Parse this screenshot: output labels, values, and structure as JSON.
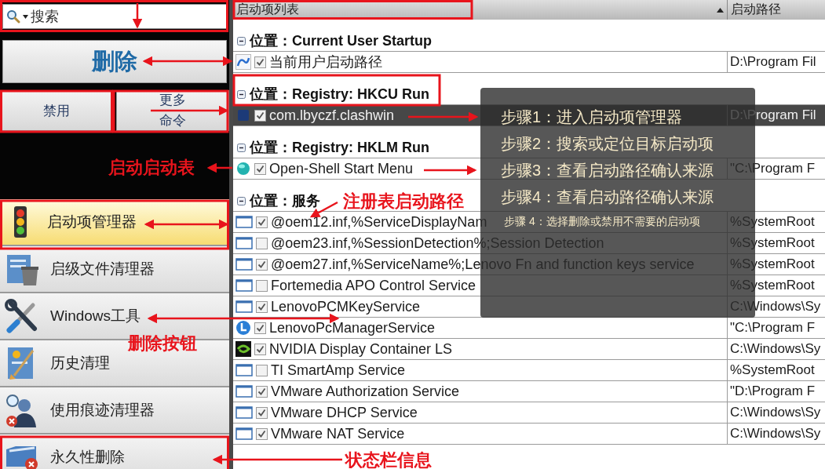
{
  "sidebar": {
    "search": {
      "placeholder": "搜索"
    },
    "delete_button": "删除",
    "buttons": [
      "禁用",
      "更多命令"
    ],
    "nav": [
      {
        "label": "启动项管理器",
        "selected": true
      },
      {
        "label": "启级文件清理器",
        "selected": false
      },
      {
        "label": "Windows工具",
        "selected": false
      },
      {
        "label": "历史清理",
        "selected": false
      },
      {
        "label": "使用痕迹清理器",
        "selected": false
      },
      {
        "label": "永久性删除",
        "selected": false
      }
    ]
  },
  "table": {
    "columns": [
      {
        "label": "启动项列表",
        "sorted": true
      },
      {
        "label": "启动路径",
        "sorted": false
      }
    ],
    "groups": [
      {
        "title": "位置：Current User Startup",
        "expanded": true,
        "items": [
          {
            "kind": "link",
            "name": "当前用户启动路径",
            "checked": true,
            "selected": false,
            "path": "D:\\Program Fil"
          }
        ]
      },
      {
        "title": "位置：Registry: HKCU Run",
        "expanded": true,
        "items": [
          {
            "kind": "app",
            "name": "com.lbyczf.clashwin",
            "checked": true,
            "selected": true,
            "path": "D:\\Program Fil"
          }
        ]
      },
      {
        "title": "位置：Registry: HKLM Run",
        "expanded": true,
        "items": [
          {
            "kind": "ball",
            "name": "Open-Shell Start Menu",
            "checked": true,
            "selected": false,
            "path": "\"C:\\Program F"
          }
        ]
      },
      {
        "title": "位置：服务",
        "expanded": true,
        "items": [
          {
            "kind": "window",
            "name": "@oem12.inf,%ServiceDisplayNam",
            "checked": true,
            "selected": false,
            "path": "%SystemRoot"
          },
          {
            "kind": "window",
            "name": "@oem23.inf,%SessionDetection%;Session Detection",
            "checked": false,
            "selected": false,
            "path": "%SystemRoot"
          },
          {
            "kind": "window",
            "name": "@oem27.inf,%ServiceName%;Lenovo Fn and function keys service",
            "checked": true,
            "selected": false,
            "path": "%SystemRoot"
          },
          {
            "kind": "window",
            "name": "Fortemedia APO Control Service",
            "checked": false,
            "selected": false,
            "path": "%SystemRoot"
          },
          {
            "kind": "window",
            "name": "LenovoPCMKeyService",
            "checked": true,
            "selected": false,
            "path": "C:\\Windows\\Sy"
          },
          {
            "kind": "round",
            "name": "LenovoPcManagerService",
            "checked": true,
            "selected": false,
            "path": "\"C:\\Program F"
          },
          {
            "kind": "chip",
            "name": "NVIDIA Display Container LS",
            "checked": true,
            "selected": false,
            "path": "C:\\Windows\\Sy"
          },
          {
            "kind": "window",
            "name": "TI SmartAmp Service",
            "checked": false,
            "selected": false,
            "path": "%SystemRoot"
          },
          {
            "kind": "window",
            "name": "VMware Authorization Service",
            "checked": true,
            "selected": false,
            "path": "\"D:\\Program F"
          },
          {
            "kind": "window",
            "name": "VMware DHCP Service",
            "checked": true,
            "selected": false,
            "path": "C:\\Windows\\Sy"
          },
          {
            "kind": "window",
            "name": "VMware NAT Service",
            "checked": true,
            "selected": false,
            "path": "C:\\Windows\\Sy"
          }
        ]
      }
    ]
  },
  "tooltip": {
    "steps": [
      {
        "kind": "main",
        "text": "步骤1：进入启动项管理器"
      },
      {
        "kind": "main",
        "text": "步骤2：搜索或定位目标启动项"
      },
      {
        "kind": "main",
        "text": "步骤3：查看启动路径确认来源"
      },
      {
        "kind": "main",
        "text": "步骤4：查看启动路径确认来源"
      },
      {
        "kind": "note",
        "text": "步骤 4：选择删除或禁用不需要的启动项"
      }
    ]
  },
  "annotations": [
    "启动启动表",
    "注册表启动路径",
    "删除按钮",
    "状态栏信息"
  ]
}
